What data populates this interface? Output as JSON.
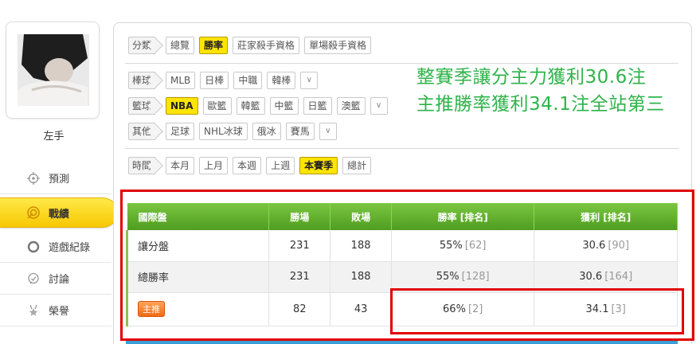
{
  "user": {
    "name": "左手"
  },
  "nav": {
    "items": [
      {
        "label": "預測",
        "icon": "crosshair-icon"
      },
      {
        "label": "戰績",
        "icon": "target-icon"
      },
      {
        "label": "遊戲紀錄",
        "icon": "ring-icon"
      },
      {
        "label": "討論",
        "icon": "chat-icon"
      },
      {
        "label": "榮譽",
        "icon": "medal-icon"
      }
    ]
  },
  "filters": {
    "category": {
      "label": "分類",
      "options": [
        "總覽",
        "勝率",
        "莊家殺手資格",
        "單場殺手資格"
      ],
      "selected": "勝率"
    },
    "baseball": {
      "label": "棒球",
      "options": [
        "MLB",
        "日棒",
        "中職",
        "韓棒"
      ]
    },
    "basketball": {
      "label": "籃球",
      "options": [
        "NBA",
        "歐籃",
        "韓籃",
        "中籃",
        "日籃",
        "澳籃"
      ],
      "selected": "NBA"
    },
    "other": {
      "label": "其他",
      "options": [
        "足球",
        "NHL冰球",
        "俄冰",
        "賽馬"
      ]
    },
    "time": {
      "label": "時間",
      "options": [
        "本月",
        "上月",
        "本週",
        "上週",
        "本賽季",
        "總計"
      ],
      "selected": "本賽季"
    }
  },
  "headline": {
    "line1": "整賽季讓分主力獲利30.6注",
    "line2": "主推勝率獲利34.1注全站第三"
  },
  "table": {
    "headers": [
      "國際盤",
      "勝場",
      "敗場",
      "勝率 [排名]",
      "獲利 [排名]"
    ],
    "rows": [
      {
        "name": "讓分盤",
        "wins": "231",
        "losses": "188",
        "rate": "55%",
        "rate_rank": "[62]",
        "profit": "30.6",
        "profit_rank": "[90]"
      },
      {
        "name": "總勝率",
        "wins": "231",
        "losses": "188",
        "rate": "55%",
        "rate_rank": "[128]",
        "profit": "30.6",
        "profit_rank": "[164]"
      },
      {
        "name": "主推",
        "wins": "82",
        "losses": "43",
        "rate": "66%",
        "rate_rank": "[2]",
        "profit": "34.1",
        "profit_rank": "[3]"
      }
    ]
  },
  "colors": {
    "accent_yellow": "#ffe400",
    "table_green": "#5aa82a",
    "headline_green": "#2fb34a",
    "highlight_red": "#e10000"
  }
}
